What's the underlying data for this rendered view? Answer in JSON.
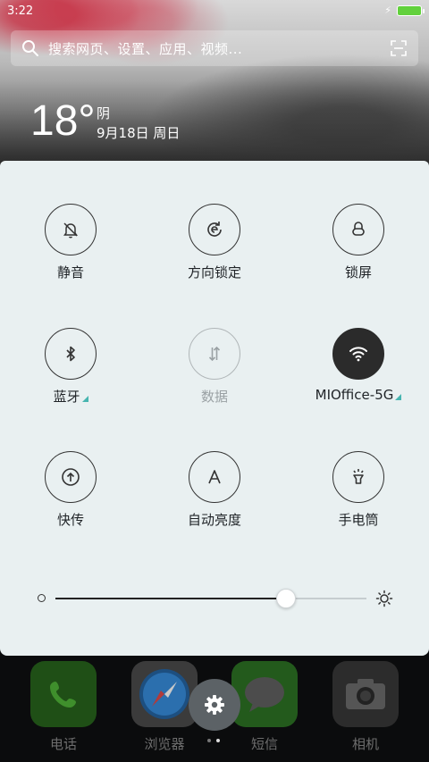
{
  "status_bar": {
    "time": "3:22",
    "charging_icon": "bolt-icon",
    "battery_color": "#62d13c"
  },
  "search": {
    "placeholder": "搜索网页、设置、应用、视频..."
  },
  "weather": {
    "temperature": "18°",
    "condition": "阴",
    "date": "9月18日 周日"
  },
  "quick_toggles": [
    {
      "label": "静音",
      "icon": "bell-off-icon",
      "state": "off"
    },
    {
      "label": "方向锁定",
      "icon": "rotation-lock-icon",
      "state": "off"
    },
    {
      "label": "锁屏",
      "icon": "lock-icon",
      "state": "off"
    },
    {
      "label": "蓝牙",
      "icon": "bluetooth-icon",
      "state": "off",
      "expandable": true
    },
    {
      "label": "数据",
      "icon": "mobile-data-icon",
      "state": "disabled"
    },
    {
      "label": "MIOffice-5G",
      "icon": "wifi-icon",
      "state": "on",
      "expandable": true
    },
    {
      "label": "快传",
      "icon": "transfer-icon",
      "state": "off"
    },
    {
      "label": "自动亮度",
      "icon": "auto-brightness-icon",
      "state": "off"
    },
    {
      "label": "手电筒",
      "icon": "flashlight-icon",
      "state": "off"
    }
  ],
  "brightness": {
    "level": 0.74
  },
  "dock": [
    {
      "label": "电话",
      "icon": "phone-icon"
    },
    {
      "label": "浏览器",
      "icon": "compass-icon"
    },
    {
      "label": "短信",
      "icon": "message-icon"
    },
    {
      "label": "相机",
      "icon": "camera-icon"
    }
  ],
  "settings_button": {
    "icon": "gear-icon"
  },
  "page_indicator": {
    "count": 2,
    "current": 2
  },
  "colors": {
    "panel_bg": "#e9f0f1",
    "accent_teal": "#46b5b0",
    "active_toggle": "#2b2b2b"
  }
}
